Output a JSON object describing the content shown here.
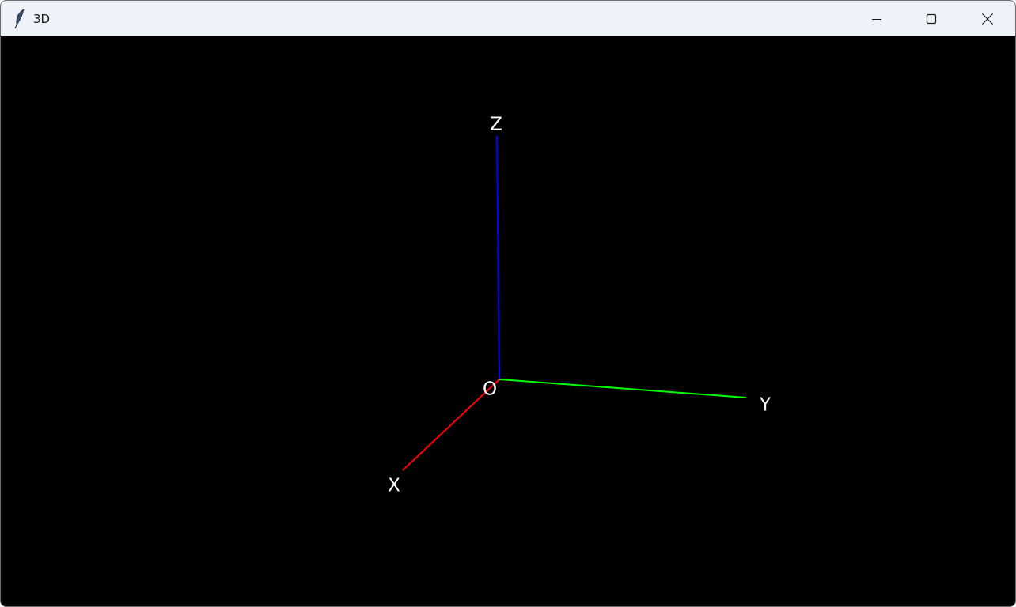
{
  "window": {
    "title": "3D",
    "app_icon": "feather-icon",
    "controls": {
      "minimize_icon": "minimize-icon",
      "maximize_icon": "maximize-icon",
      "close_icon": "close-icon"
    }
  },
  "scene": {
    "background": "#000000",
    "origin_label": "O",
    "axes": [
      {
        "name": "x",
        "label": "X",
        "color": "#ff0000"
      },
      {
        "name": "y",
        "label": "Y",
        "color": "#00ff00"
      },
      {
        "name": "z",
        "label": "Z",
        "color": "#0000ff"
      }
    ],
    "label_color": "#ffffff"
  }
}
